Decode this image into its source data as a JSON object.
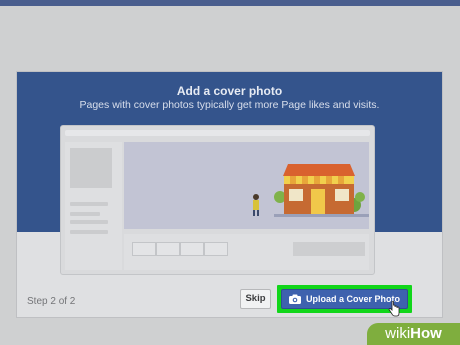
{
  "dialog": {
    "title": "Add a cover photo",
    "subtitle": "Pages with cover photos typically get more Page likes and visits.",
    "step_text": "Step 2 of 2",
    "skip_label": "Skip",
    "upload_label": "Upload a Cover Photo",
    "upload_icon": "camera-icon"
  },
  "watermark": {
    "part1": "wiki",
    "part2": "How"
  },
  "colors": {
    "hero_bg": "#34548c",
    "upload_button": "#3e62ae",
    "highlight": "#11d61a",
    "watermark_bg": "#7fae3e"
  }
}
